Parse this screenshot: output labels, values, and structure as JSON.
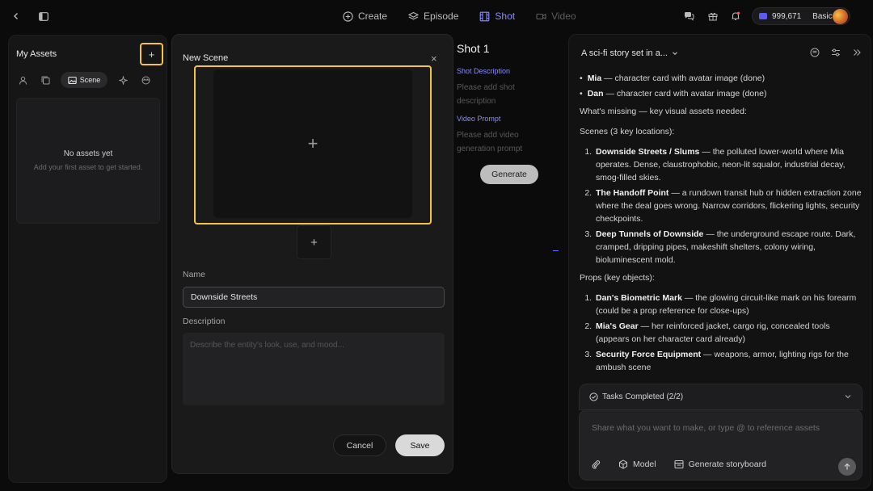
{
  "topbar": {
    "tabs": [
      {
        "label": "Create",
        "icon": "plus-circle-icon",
        "state": "normal"
      },
      {
        "label": "Episode",
        "icon": "layers-icon",
        "state": "normal"
      },
      {
        "label": "Shot",
        "icon": "film-icon",
        "state": "active"
      },
      {
        "label": "Video",
        "icon": "video-icon",
        "state": "disabled"
      }
    ],
    "credits": "999,671",
    "plan": "Basic",
    "accent_color": "#8b8cff"
  },
  "assets": {
    "title": "My Assets",
    "add_label": "+",
    "active_tab": "Scene",
    "empty_title": "No assets yet",
    "empty_subtitle": "Add your first asset to get started."
  },
  "modal": {
    "title": "New Scene",
    "close": "×",
    "upload_plus": "+",
    "name_label": "Name",
    "name_value": "Downside Streets",
    "description_label": "Description",
    "description_placeholder": "Describe the entity's look, use, and mood...",
    "cancel": "Cancel",
    "save": "Save",
    "highlight_color": "#f5c342"
  },
  "shot": {
    "title": "Shot 1",
    "description_label": "Shot Description",
    "description_placeholder": "Please add shot description",
    "video_prompt_label": "Video Prompt",
    "video_prompt_placeholder": "Please add video generation prompt",
    "generate": "Generate"
  },
  "chat": {
    "title": "A sci-fi story set in a...",
    "bullets": [
      {
        "name": "Mia",
        "text": " — character card with avatar image (done)"
      },
      {
        "name": "Dan",
        "text": " — character card with avatar image (done)"
      }
    ],
    "missing_heading": "What's missing — key visual assets needed:",
    "scenes_heading": "Scenes (3 key locations):",
    "scenes": [
      {
        "name": "Downside Streets / Slums",
        "text": " — the polluted lower-world where Mia operates. Dense, claustrophobic, neon-lit squalor, industrial decay, smog-filled skies."
      },
      {
        "name": "The Handoff Point",
        "text": " — a rundown transit hub or hidden extraction zone where the deal goes wrong. Narrow corridors, flickering lights, security checkpoints."
      },
      {
        "name": "Deep Tunnels of Downside",
        "text": " — the underground escape route. Dark, cramped, dripping pipes, makeshift shelters, colony wiring, bioluminescent mold."
      }
    ],
    "props_heading": "Props (key objects):",
    "props": [
      {
        "name": "Dan's Biometric Mark",
        "text": " — the glowing circuit-like mark on his forearm (could be a prop reference for close-ups)"
      },
      {
        "name": "Mia's Gear",
        "text": " — her reinforced jacket, cargo rig, concealed tools (appears on her character card already)"
      },
      {
        "name": "Security Force Equipment",
        "text": " — weapons, armor, lighting rigs for the ambush scene"
      }
    ],
    "tasks": "Tasks Completed (2/2)",
    "composer_placeholder": "Share what you want to make, or type @ to reference assets",
    "model_label": "Model",
    "storyboard_label": "Generate storyboard"
  }
}
